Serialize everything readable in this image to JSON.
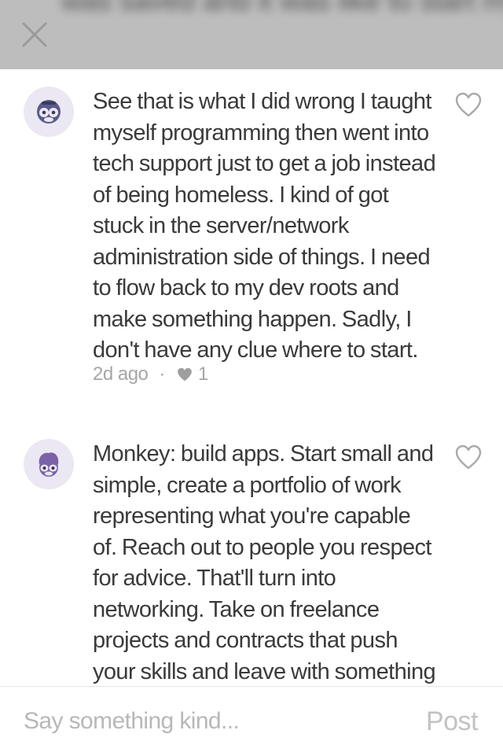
{
  "header": {
    "blurred_text": "was saved and it was like to start my own company, feeling with the world behind",
    "close_icon": "close-icon"
  },
  "comments": [
    {
      "avatar_icon": "monkey-face-icon",
      "text": "See that is what I did wrong I taught myself programming then went into tech support just to get a job instead of being homeless. I kind of got stuck in the server/network administration side of things. I need to flow back to my dev roots and make something happen. Sadly, I don't have any clue where to start.",
      "time": "2d ago",
      "separator": "·",
      "likes": "1",
      "like_icon": "heart-outline-icon",
      "likes_icon": "heart-filled-icon"
    },
    {
      "avatar_icon": "monkey-hair-icon",
      "text": "Monkey: build apps. Start small and simple, create a portfolio of work representing what you're capable of. Reach out to people you respect for advice. That'll turn into networking. Take on freelance projects and contracts that push your skills and leave with something you can show in",
      "like_icon": "heart-outline-icon"
    }
  ],
  "composer": {
    "placeholder": "Say something kind...",
    "post_label": "Post"
  },
  "colors": {
    "header_bg": "#bdbdbd",
    "avatar_bg": "#ebe8f3",
    "avatar_accent": "#7a62a8",
    "text": "#3a3a3a",
    "muted": "#a6a6a6"
  }
}
